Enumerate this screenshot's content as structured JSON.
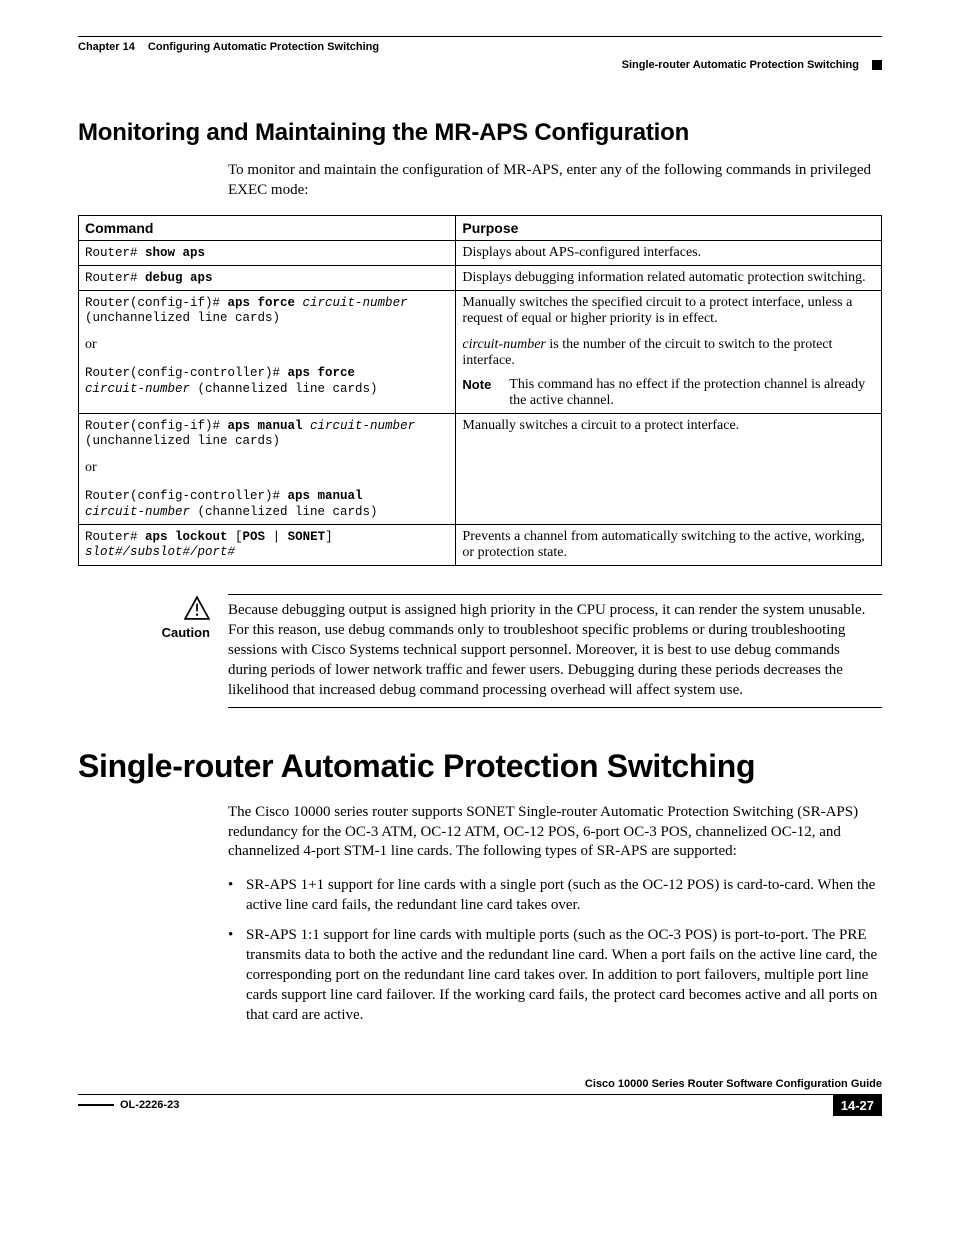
{
  "header": {
    "chapter_label": "Chapter 14",
    "chapter_title": "Configuring Automatic Protection Switching",
    "section_title": "Single-router Automatic Protection Switching"
  },
  "section1": {
    "heading": "Monitoring and Maintaining the MR-APS Configuration",
    "intro": "To monitor and maintain the configuration of MR-APS, enter any of the following commands in privileged EXEC mode:"
  },
  "table": {
    "col1": "Command",
    "col2": "Purpose",
    "rows": {
      "r1": {
        "cmd_pre": "Router# ",
        "cmd_bold": "show aps",
        "purpose": "Displays about APS-configured interfaces."
      },
      "r2": {
        "cmd_pre": "Router# ",
        "cmd_bold": "debug aps",
        "purpose": "Displays debugging information related automatic protection switching."
      },
      "r3": {
        "l1_pre": "Router(config-if)# ",
        "l1_bold": "aps force",
        "l1_ital": " circuit-number",
        "l2": "(unchannelized line cards)",
        "or": "or",
        "l3_pre": "Router(config-controller)# ",
        "l3_bold": "aps force",
        "l4_ital": "circuit-number",
        "l4_after": " (channelized line cards)",
        "p1": "Manually switches the specified circuit to a protect interface, unless a request of equal or higher priority is in effect.",
        "p2_ital": "circuit-number",
        "p2_after": " is the number of the circuit to switch to the protect interface.",
        "note_label": "Note",
        "note_text": "This command has no effect if the protection channel is already the active channel."
      },
      "r4": {
        "l1_pre": "Router(config-if)# ",
        "l1_bold": "aps manual",
        "l1_ital": " circuit-number",
        "l2": "(unchannelized line cards)",
        "or": "or",
        "l3_pre": "Router(config-controller)# ",
        "l3_bold": "aps manual",
        "l4_ital": "circuit-number",
        "l4_after": " (channelized line cards)",
        "purpose": "Manually switches a circuit to a protect interface."
      },
      "r5": {
        "l1_pre": "Router# ",
        "l1_bold1": "aps lockout",
        "l1_mid": " [",
        "l1_bold2": "POS",
        "l1_pipe": " | ",
        "l1_bold3": "SONET",
        "l1_end": "]",
        "l2_ital": "slot#/subslot#/port#",
        "purpose": "Prevents a channel from automatically switching to the active, working, or protection state."
      }
    }
  },
  "caution": {
    "label": "Caution",
    "text": "Because debugging output is assigned high priority in the CPU process, it can render the system unusable. For this reason, use debug commands only to troubleshoot specific problems or during troubleshooting sessions with Cisco Systems technical support personnel. Moreover, it is best to use debug commands during periods of lower network traffic and fewer users. Debugging during these periods decreases the likelihood that increased debug command processing overhead will affect system use."
  },
  "section2": {
    "heading": "Single-router Automatic Protection Switching",
    "intro": "The Cisco 10000 series router supports SONET Single-router Automatic Protection Switching (SR-APS) redundancy for the OC-3 ATM, OC-12 ATM, OC-12 POS, 6-port OC-3 POS, channelized OC-12, and channelized 4-port STM-1 line cards. The following types of SR-APS are supported:",
    "bullets": [
      "SR-APS 1+1 support for line cards with a single port (such as the OC-12 POS) is card-to-card. When the active line card fails, the redundant line card takes over.",
      "SR-APS 1:1 support for line cards with multiple ports (such as the OC-3 POS) is port-to-port. The PRE transmits data to both the active and the redundant line card. When a port fails on the active line card, the corresponding port on the redundant line card takes over. In addition to port failovers, multiple port line cards support line card failover. If the working card fails, the protect card becomes active and all ports on that card are active."
    ]
  },
  "footer": {
    "book": "Cisco 10000 Series Router Software Configuration Guide",
    "doc_id": "OL-2226-23",
    "page": "14-27"
  }
}
